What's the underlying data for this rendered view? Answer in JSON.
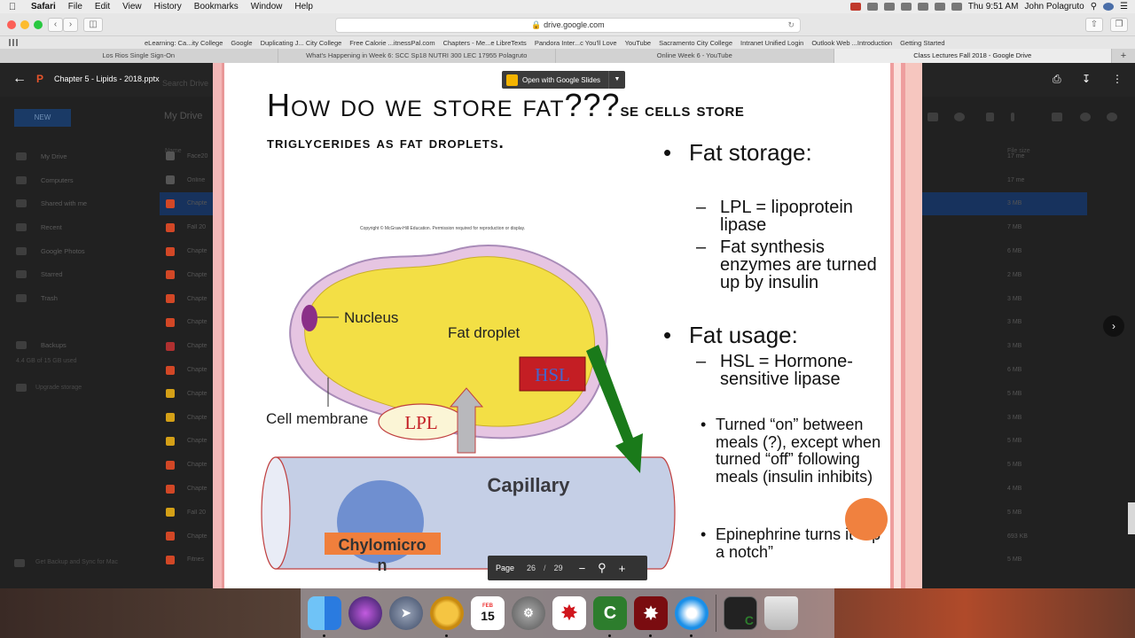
{
  "menubar": {
    "app": "Safari",
    "items": [
      "File",
      "Edit",
      "View",
      "History",
      "Bookmarks",
      "Window",
      "Help"
    ],
    "clock": "Thu 9:51 AM",
    "user": "John Polagruto"
  },
  "browser": {
    "url": "drive.google.com",
    "bookmarks": [
      "eLearning: Ca...ity College",
      "Google",
      "Duplicating J... City College",
      "Free Calorie ...itnessPal.com",
      "Chapters - Me...e LibreTexts",
      "Pandora Inter...c You'll Love",
      "YouTube",
      "Sacramento City College",
      "Intranet Unified Login",
      "Outlook Web ...Introduction",
      "Getting Started"
    ],
    "tabs": [
      "Los Rios Single Sign-On",
      "What's Happening in Week 6: SCC Sp18 NUTRI 300 LEC 17955 Polagruto",
      "Online Week 6 - YouTube",
      "Class Lectures Fall 2018 - Google Drive"
    ],
    "active_tab": 3
  },
  "drive": {
    "new_label": "NEW",
    "heading": "My Drive",
    "search_label": "Search Drive",
    "nav": [
      "My Drive",
      "Computers",
      "Shared with me",
      "Recent",
      "Google Photos",
      "Starred",
      "Trash",
      "",
      "Backups"
    ],
    "storage": "4.4 GB of 15 GB used",
    "upgrade": "Upgrade storage",
    "backup_sync": "Get Backup and Sync for Mac",
    "col_name": "Name",
    "col_size": "File size",
    "files": [
      {
        "name": "Face20",
        "color": "#555555",
        "size": "17 me"
      },
      {
        "name": "Online",
        "color": "#555555",
        "size": "17 me"
      },
      {
        "name": "Chapte",
        "color": "#d24726",
        "size": "3 MB",
        "selected": true
      },
      {
        "name": "Fall 20",
        "color": "#d24726",
        "size": "7 MB"
      },
      {
        "name": "Chapte",
        "color": "#d24726",
        "size": "6 MB"
      },
      {
        "name": "Chapte",
        "color": "#d24726",
        "size": "2 MB"
      },
      {
        "name": "Chapte",
        "color": "#d24726",
        "size": "3 MB"
      },
      {
        "name": "Chapte",
        "color": "#d24726",
        "size": "3 MB"
      },
      {
        "name": "Chapte",
        "color": "#b03030",
        "size": "3 MB"
      },
      {
        "name": "Chapte",
        "color": "#d24726",
        "size": "6 MB"
      },
      {
        "name": "Chapte",
        "color": "#d4a017",
        "size": "5 MB"
      },
      {
        "name": "Chapte",
        "color": "#d4a017",
        "size": "3 MB"
      },
      {
        "name": "Chapte",
        "color": "#d4a017",
        "size": "5 MB"
      },
      {
        "name": "Chapte",
        "color": "#d24726",
        "size": "5 MB"
      },
      {
        "name": "Chapte",
        "color": "#d24726",
        "size": "4 MB"
      },
      {
        "name": "Fall 20",
        "color": "#d4a017",
        "size": "5 MB"
      },
      {
        "name": "Chapte",
        "color": "#d24726",
        "size": "693 KB"
      },
      {
        "name": "Fitnes",
        "color": "#d24726",
        "size": "5 MB"
      }
    ]
  },
  "preview": {
    "filename": "Chapter 5 - Lipids - 2018.pptx",
    "open_with": "Open with Google Slides",
    "page_label": "Page",
    "page": "26",
    "page_sep": "/",
    "total": "29"
  },
  "slide": {
    "title_big": "How do we store fat???",
    "title_rest": "se cells store",
    "subtitle": "triglycerides as fat droplets.",
    "copyright": "Copyright © McGraw-Hill Education. Permission required for reproduction or display.",
    "labels": {
      "nucleus": "Nucleus",
      "fat_droplet": "Fat droplet",
      "hsl": "HSL",
      "cell_membrane": "Cell membrane",
      "lpl": "LPL",
      "capillary": "Capillary",
      "chylomicron_1": "Chylomicro",
      "chylomicron_2": "n"
    },
    "bullets": {
      "storage": "Fat storage:",
      "lpl": "LPL = lipoprotein lipase",
      "synthesis": "Fat synthesis enzymes are turned up by insulin",
      "usage": "Fat usage:",
      "hsl": "HSL = Hormone-sensitive lipase",
      "turned_on": "Turned  “on” between meals (?), except when turned “off” following meals (insulin inhibits)",
      "epinephrine": "Epinephrine turns it “up a notch”"
    }
  },
  "dock": {
    "calendar_month": "FEB",
    "calendar_day": "15"
  }
}
